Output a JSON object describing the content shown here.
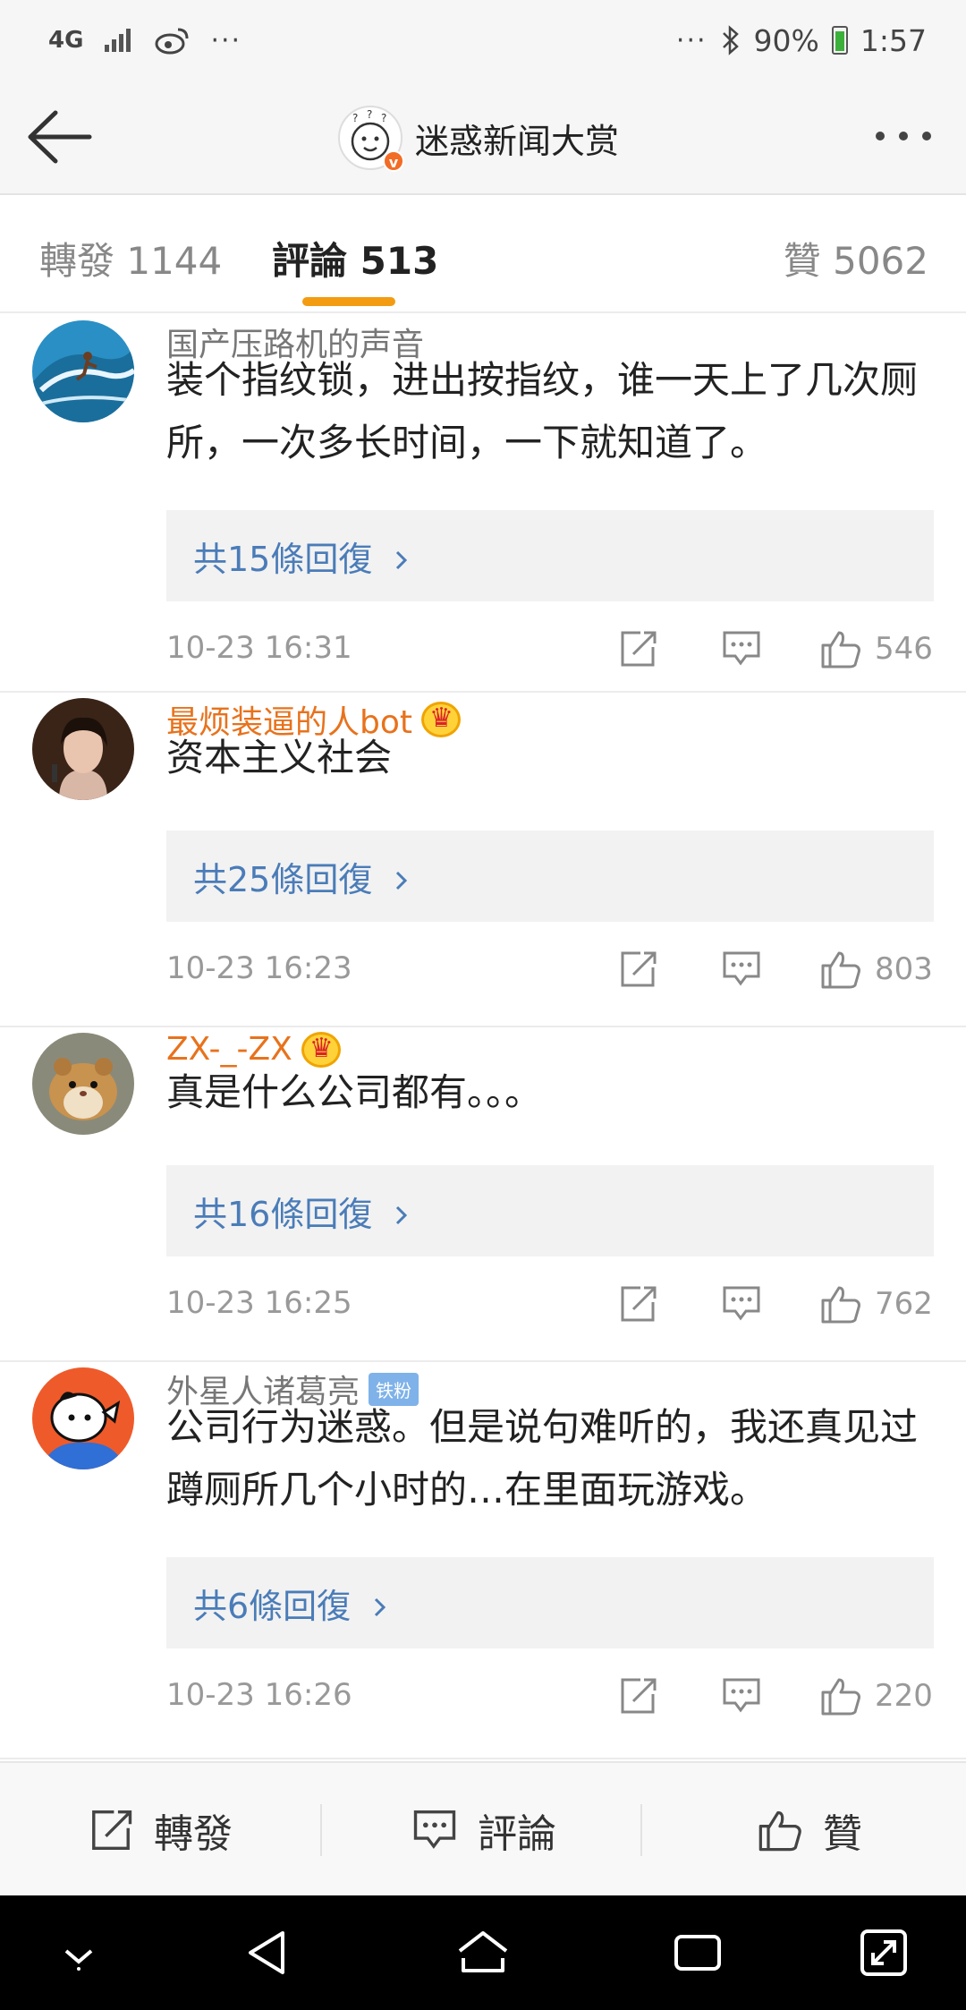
{
  "status_bar": {
    "network": "4G",
    "battery": "90%",
    "time": "1:57",
    "left_more": "···",
    "right_more": "···"
  },
  "header": {
    "title": "迷惑新闻大赏",
    "verified_mark": "v",
    "back_icon": "back-arrow-icon",
    "more_icon": "more-dots-icon"
  },
  "tabs": {
    "repost": "轉發 1144",
    "comment": "評論 513",
    "like": "贊 5062",
    "active": "comment",
    "indicator_color": "#f39c12"
  },
  "comments": [
    {
      "name": "国产压路机的声音",
      "vip": false,
      "badge": "",
      "text": "装个指纹锁，进出按指纹，谁一天上了几次厕所，一次多长时间，一下就知道了。",
      "replies": "共15條回復",
      "time": "10-23 16:31",
      "likes": "546"
    },
    {
      "name": "最烦装逼的人bot",
      "vip": true,
      "badge": "",
      "text": "资本主义社会",
      "replies": "共25條回復",
      "time": "10-23 16:23",
      "likes": "803"
    },
    {
      "name": "ZX-_-ZX",
      "vip": true,
      "badge": "",
      "text": "真是什么公司都有。。。",
      "replies": "共16條回復",
      "time": "10-23 16:25",
      "likes": "762"
    },
    {
      "name": "外星人诸葛亮",
      "vip": false,
      "badge": "铁粉",
      "text": "公司行为迷惑。但是说句难听的，我还真见过蹲厕所几个小时的…在里面玩游戏。",
      "replies": "共6條回復",
      "time": "10-23 16:26",
      "likes": "220"
    }
  ],
  "bottom_bar": {
    "repost": "轉發",
    "comment": "評論",
    "like": "贊"
  },
  "colors": {
    "vip_name": "#e8721c",
    "reply_link": "#4a7cb8",
    "nav_bar": "#000000"
  }
}
